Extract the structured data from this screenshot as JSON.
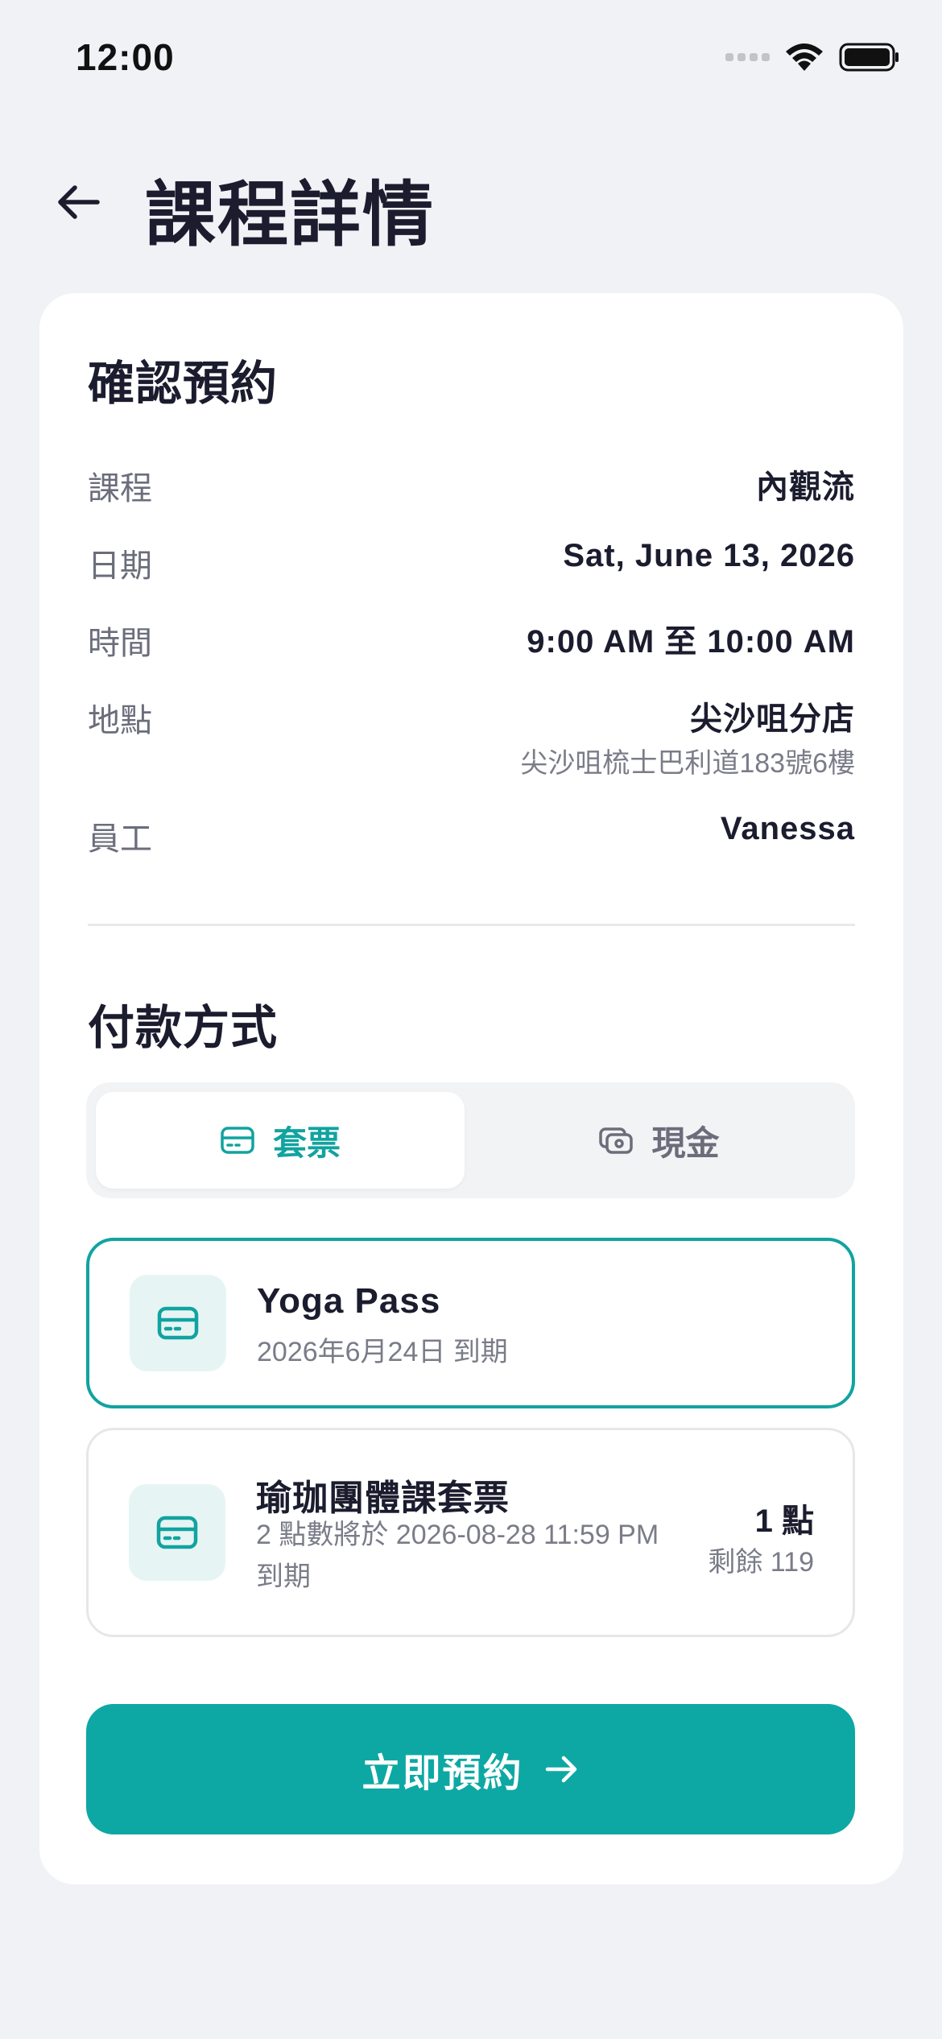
{
  "status_bar": {
    "time": "12:00"
  },
  "header": {
    "title": "課程詳情",
    "back_icon": "arrow-left-icon"
  },
  "booking": {
    "title": "確認預約",
    "rows": {
      "course": {
        "label": "課程",
        "value": "內觀流"
      },
      "date": {
        "label": "日期",
        "value": "Sat, June 13, 2026"
      },
      "time": {
        "label": "時間",
        "value": "9:00 AM 至 10:00 AM"
      },
      "location": {
        "label": "地點",
        "value": "尖沙咀分店",
        "sub": "尖沙咀梳士巴利道183號6樓"
      },
      "staff": {
        "label": "員工",
        "value": "Vanessa"
      }
    }
  },
  "payment": {
    "title": "付款方式",
    "tabs": [
      {
        "label": "套票",
        "icon": "card-icon",
        "active": true
      },
      {
        "label": "現金",
        "icon": "cash-icon",
        "active": false
      }
    ],
    "options": [
      {
        "title": "Yoga Pass",
        "subtitle": "2026年6月24日 到期",
        "selected": true
      },
      {
        "title": "瑜珈團體課套票",
        "subtitle": "2 點數將於 2026-08-28 11:59 PM 到期",
        "right_main": "1 點",
        "right_sub": "剩餘 119",
        "selected": false
      }
    ]
  },
  "cta": {
    "label": "立即預約",
    "icon": "arrow-right-icon"
  },
  "colors": {
    "accent": "#0ea8a4",
    "background": "#f1f2f6",
    "text": "#1b1c2e",
    "muted": "#6b6d7b"
  }
}
